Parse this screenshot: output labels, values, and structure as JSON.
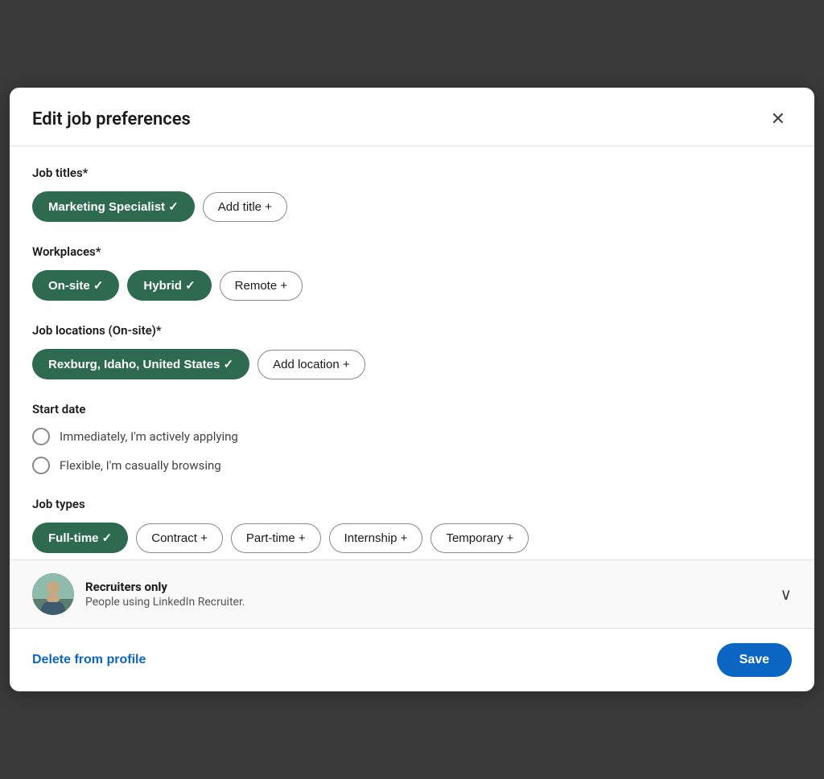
{
  "modal": {
    "title": "Edit job preferences",
    "close_label": "✕"
  },
  "sections": {
    "job_titles": {
      "label": "Job titles*",
      "selected_chips": [
        {
          "id": "marketing-specialist",
          "text": "Marketing Specialist ✓"
        }
      ],
      "add_button": "Add title  +"
    },
    "workplaces": {
      "label": "Workplaces*",
      "selected_chips": [
        {
          "id": "on-site",
          "text": "On-site ✓"
        },
        {
          "id": "hybrid",
          "text": "Hybrid ✓"
        }
      ],
      "add_chips": [
        {
          "id": "remote",
          "text": "Remote +"
        }
      ]
    },
    "job_locations": {
      "label": "Job locations (On-site)*",
      "selected_chips": [
        {
          "id": "rexburg",
          "text": "Rexburg, Idaho, United States ✓"
        }
      ],
      "add_button": "Add location  +"
    },
    "start_date": {
      "label": "Start date",
      "options": [
        {
          "id": "immediately",
          "text": "Immediately, I'm actively applying"
        },
        {
          "id": "flexible",
          "text": "Flexible, I'm casually browsing"
        }
      ]
    },
    "job_types": {
      "label": "Job types",
      "selected_chips": [
        {
          "id": "full-time",
          "text": "Full-time ✓"
        }
      ],
      "add_chips": [
        {
          "id": "contract",
          "text": "Contract +"
        },
        {
          "id": "part-time",
          "text": "Part-time +"
        },
        {
          "id": "internship",
          "text": "Internship +"
        },
        {
          "id": "temporary",
          "text": "Temporary +"
        }
      ]
    }
  },
  "recruiter_bar": {
    "title": "Recruiters only",
    "subtitle": "People using LinkedIn Recruiter.",
    "chevron": "∨"
  },
  "footer": {
    "delete_label": "Delete from profile",
    "save_label": "Save"
  }
}
